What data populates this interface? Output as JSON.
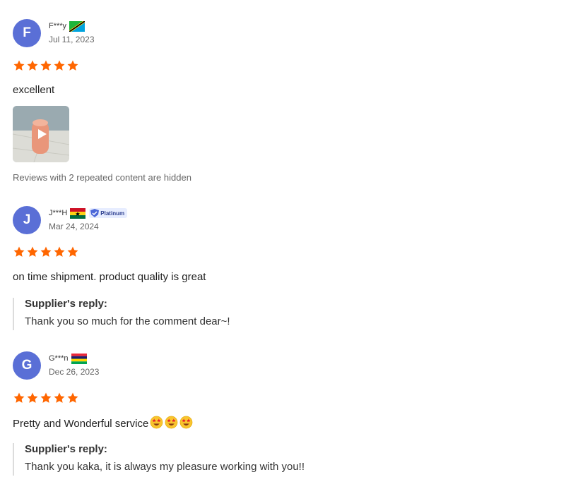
{
  "colors": {
    "avatar": "#5a6fd6",
    "star": "#ff6600",
    "reply_border": "#dcdcdc"
  },
  "reviews": [
    {
      "initial": "F",
      "name": "F***y",
      "flag": "tanzania-flag",
      "date": "Jul 11, 2023",
      "rating": 5,
      "text": "excellent",
      "media": {
        "type": "video",
        "icon": "play-icon"
      },
      "hidden_note": "Reviews with 2 repeated content are hidden"
    },
    {
      "initial": "J",
      "name": "J***H",
      "flag": "ghana-flag",
      "badge": "Platinum",
      "date": "Mar 24, 2024",
      "rating": 5,
      "text": "on time shipment. product quality is great",
      "reply": {
        "title": "Supplier's reply:",
        "text": "Thank you so much for the comment dear~!"
      }
    },
    {
      "initial": "G",
      "name": "G***n",
      "flag": "mauritius-flag",
      "date": "Dec 26, 2023",
      "rating": 5,
      "text": "Pretty and Wonderful service",
      "emoji": "star-struck-emoji",
      "emoji_count": 3,
      "reply": {
        "title": "Supplier's reply:",
        "text": "Thank you kaka, it is always my pleasure working with you!!"
      }
    }
  ]
}
